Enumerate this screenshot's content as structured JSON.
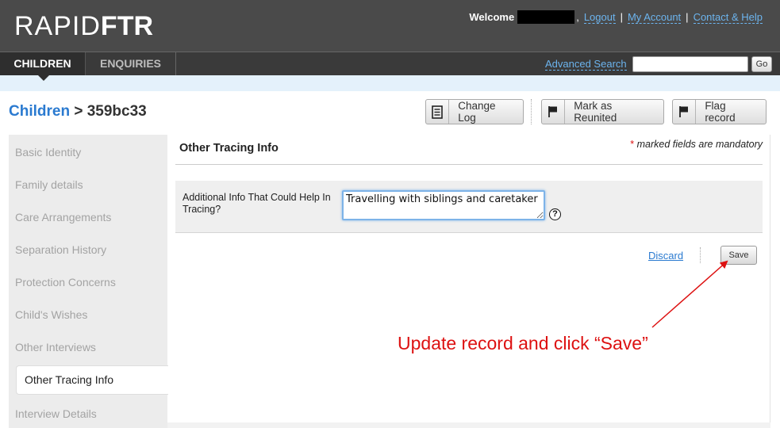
{
  "header": {
    "logo_thin": "RAPID",
    "logo_bold": "FTR",
    "welcome": "Welcome",
    "links": [
      "Logout",
      "My Account",
      "Contact & Help"
    ],
    "separator": "|"
  },
  "nav": {
    "tabs": [
      {
        "label": "CHILDREN",
        "active": true
      },
      {
        "label": "ENQUIRIES",
        "active": false
      }
    ],
    "advanced_search": "Advanced Search",
    "search_value": "",
    "go_label": "Go"
  },
  "page": {
    "breadcrumb_parent": "Children",
    "breadcrumb_sep": ">",
    "record_id": "359bc33"
  },
  "actions": {
    "change_log": "Change Log",
    "mark_reunited": "Mark as Reunited",
    "flag_record": "Flag record"
  },
  "sidebar": {
    "items": [
      "Basic Identity",
      "Family details",
      "Care Arrangements",
      "Separation History",
      "Protection Concerns",
      "Child's Wishes",
      "Other Interviews",
      "Other Tracing Info",
      "Interview Details"
    ],
    "active_index": 7
  },
  "form": {
    "section_title": "Other Tracing Info",
    "mandatory_star": "*",
    "mandatory_note": "marked fields are mandatory",
    "field_label": "Additional Info That Could Help In Tracing?",
    "field_value": "Travelling with siblings and caretaker",
    "help_glyph": "?",
    "discard_label": "Discard",
    "save_label": "Save"
  },
  "annotation": {
    "text": "Update record and click “Save”",
    "color": "#dd1111"
  }
}
